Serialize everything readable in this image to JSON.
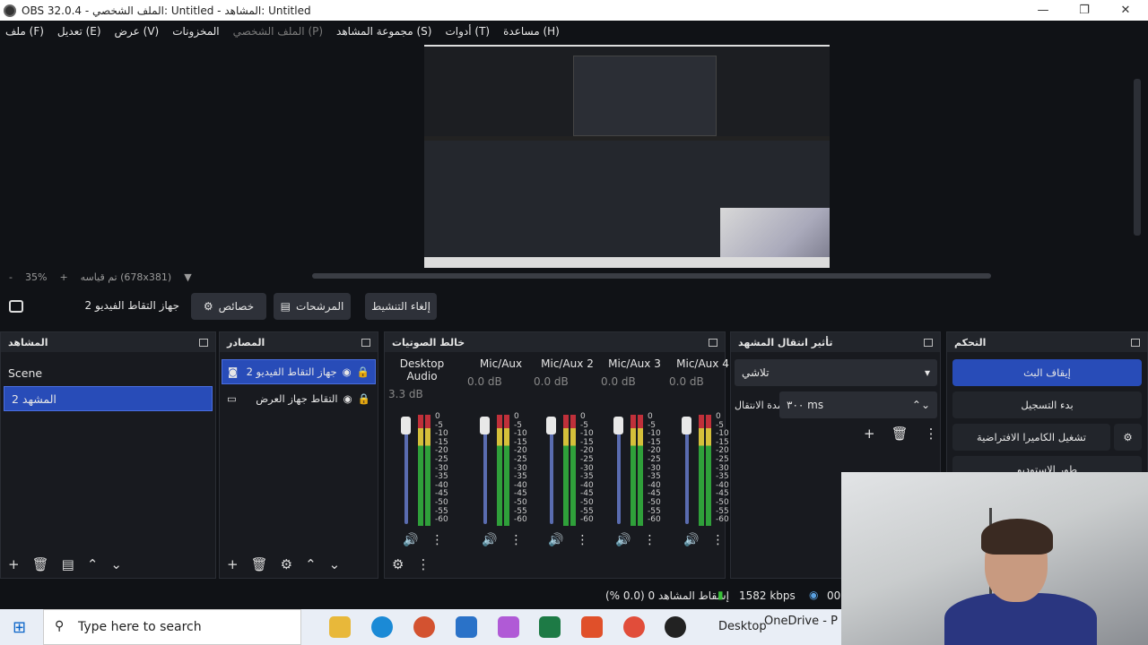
{
  "window": {
    "title": "OBS 32.0.4 - الملف الشخصي: Untitled - المشاهد: Untitled",
    "minimize": "—",
    "maximize": "❐",
    "close": "✕"
  },
  "menu": [
    "ملف (F)",
    "تعديل (E)",
    "عرض (V)",
    "المخزونات",
    "الملف الشخصي (P)",
    "مجموعة المشاهد (S)",
    "أدوات (T)",
    "مساعدة (H)"
  ],
  "zoom": {
    "minus": "-",
    "percent": "35%",
    "plus": "+",
    "mode": "تم قياسه (678x381)",
    "dropdown": "▼"
  },
  "context_bar": {
    "source": "جهاز التقاط الفيديو 2",
    "properties": "خصائص",
    "filters": "المرشحات",
    "deactivate": "إلغاء التنشيط"
  },
  "scenes": {
    "title": "المشاهد",
    "items": [
      "Scene",
      "المشهد 2"
    ],
    "selected": 1
  },
  "sources": {
    "title": "المصادر",
    "items": [
      "جهاز التقاط الفيديو 2",
      "التقاط جهاز العرض"
    ]
  },
  "mixer": {
    "title": "خالط الصوتيات",
    "channels": [
      {
        "name": "Desktop Audio",
        "db": "3.3 dB"
      },
      {
        "name": "Mic/Aux",
        "db": "0.0 dB"
      },
      {
        "name": "Mic/Aux 2",
        "db": "0.0 dB"
      },
      {
        "name": "Mic/Aux 3",
        "db": "0.0 dB"
      },
      {
        "name": "Mic/Aux 4",
        "db": "0.0 dB"
      }
    ],
    "scale": [
      "0",
      "-5",
      "-10",
      "-15",
      "-20",
      "-25",
      "-30",
      "-35",
      "-40",
      "-45",
      "-50",
      "-55",
      "-60"
    ]
  },
  "transitions": {
    "title": "تأثير انتقال المشهد",
    "type": "تلاشي",
    "duration_label": "مدة الانتقال",
    "duration": "٣٠٠ ms"
  },
  "controls": {
    "title": "التحكم",
    "stop_stream": "إيقاف البث",
    "start_record": "بدء التسجيل",
    "virtual_cam": "تشغيل الكاميرا الافتراضية",
    "studio_mode": "طور الاستوديو"
  },
  "status": {
    "dropped": "إسقاط المشاهد 0 (0.0 %)",
    "bitrate": "1582 kbps",
    "time": "00"
  },
  "taskbar": {
    "search_placeholder": "Type here to search",
    "desktop": "Desktop",
    "onedrive": "OneDrive - P"
  },
  "colors": {
    "accent": "#284cb8",
    "bg": "#101216",
    "dock": "#181a1f"
  }
}
